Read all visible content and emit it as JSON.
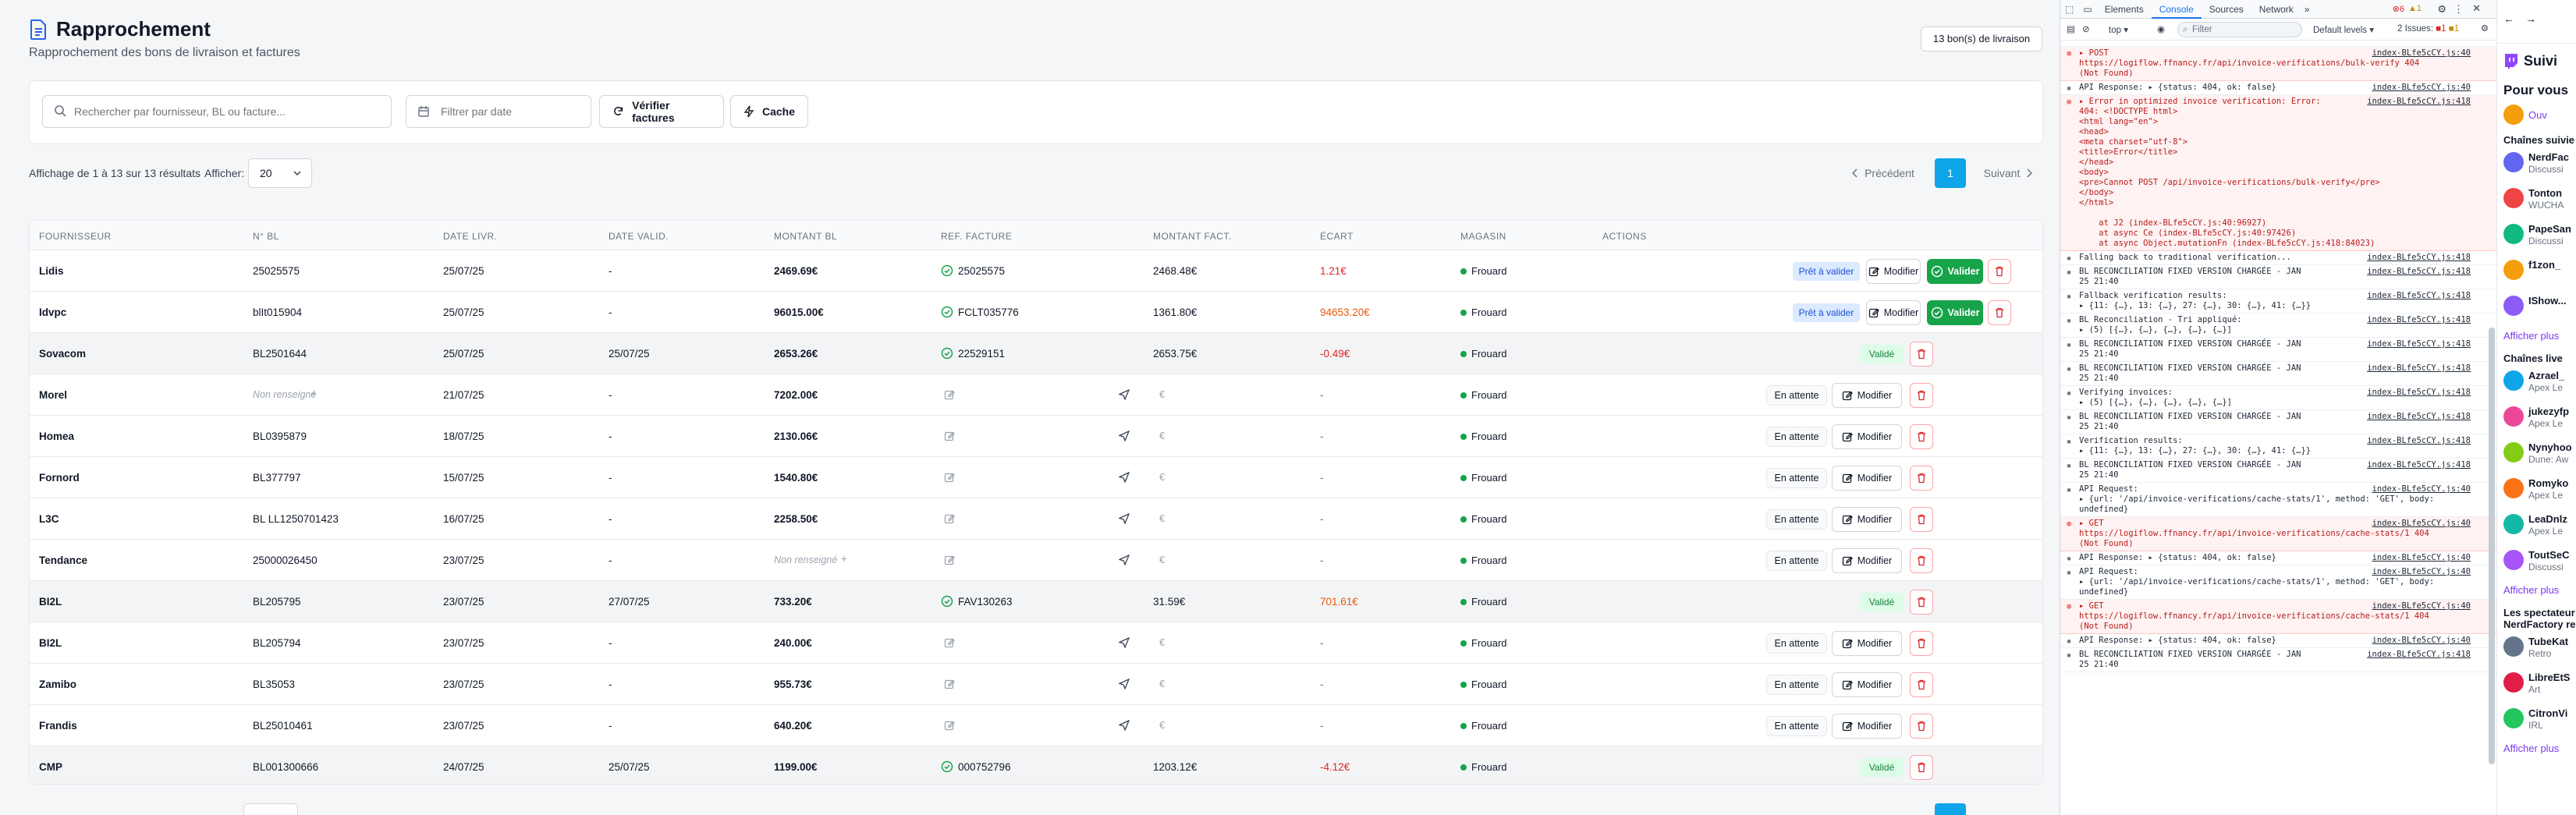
{
  "app": {
    "title": "Rapprochement",
    "subtitle": "Rapprochement des bons de livraison et factures",
    "count_badge": "13 bon(s) de livraison"
  },
  "filters": {
    "search_placeholder": "Rechercher par fournisseur, BL ou facture...",
    "date_placeholder": "Filtrer par date",
    "verify_label": "Vérifier factures",
    "cache_label": "Cache"
  },
  "pagination": {
    "info": "Affichage de 1 à 13 sur 13 résultats",
    "show_label": "Afficher:",
    "per_page": "20",
    "prev": "Précédent",
    "current": "1",
    "next": "Suivant"
  },
  "table": {
    "headers": [
      "FOURNISSEUR",
      "N° BL",
      "DATE LIVR.",
      "DATE VALID.",
      "MONTANT BL",
      "REF. FACTURE",
      "MONTANT FACT.",
      "ÉCART",
      "MAGASIN",
      "ACTIONS"
    ],
    "labels": {
      "ready": "Prêt à valider",
      "edit": "Modifier",
      "validate": "Valider",
      "waiting": "En attente",
      "validated": "Validé",
      "not_filled": "Non renseigné",
      "euro": "€"
    },
    "rows": [
      {
        "supplier": "Lidis",
        "bl": "25025575",
        "date_livr": "25/07/25",
        "date_valid": "-",
        "amount_bl": "2469.69€",
        "ref": "25025575",
        "amount_fact": "2468.48€",
        "gap": "1.21€",
        "store": "Frouard",
        "status": "ready"
      },
      {
        "supplier": "Idvpc",
        "bl": "blIt015904",
        "date_livr": "25/07/25",
        "date_valid": "-",
        "amount_bl": "96015.00€",
        "ref": "FCLT035776",
        "amount_fact": "1361.80€",
        "gap": "94653.20€",
        "store": "Frouard",
        "status": "ready"
      },
      {
        "supplier": "Sovacom",
        "bl": "BL2501644",
        "date_livr": "25/07/25",
        "date_valid": "25/07/25",
        "amount_bl": "2653.26€",
        "ref": "22529151",
        "amount_fact": "2653.75€",
        "gap": "-0.49€",
        "store": "Frouard",
        "status": "validated"
      },
      {
        "supplier": "Morel",
        "bl": "Non renseigné",
        "date_livr": "21/07/25",
        "date_valid": "-",
        "amount_bl": "7202.00€",
        "ref": "",
        "amount_fact": "",
        "gap": "-",
        "store": "Frouard",
        "status": "waiting"
      },
      {
        "supplier": "Homea",
        "bl": "BL0395879",
        "date_livr": "18/07/25",
        "date_valid": "-",
        "amount_bl": "2130.06€",
        "ref": "",
        "amount_fact": "",
        "gap": "-",
        "store": "Frouard",
        "status": "waiting"
      },
      {
        "supplier": "Fornord",
        "bl": "BL377797",
        "date_livr": "15/07/25",
        "date_valid": "-",
        "amount_bl": "1540.80€",
        "ref": "",
        "amount_fact": "",
        "gap": "-",
        "store": "Frouard",
        "status": "waiting"
      },
      {
        "supplier": "L3C",
        "bl": "BL LL1250701423",
        "date_livr": "16/07/25",
        "date_valid": "-",
        "amount_bl": "2258.50€",
        "ref": "",
        "amount_fact": "",
        "gap": "-",
        "store": "Frouard",
        "status": "waiting"
      },
      {
        "supplier": "Tendance",
        "bl": "25000026450",
        "date_livr": "23/07/25",
        "date_valid": "-",
        "amount_bl": "Non renseigné",
        "ref": "",
        "amount_fact": "",
        "gap": "-",
        "store": "Frouard",
        "status": "waiting"
      },
      {
        "supplier": "BI2L",
        "bl": "BL205795",
        "date_livr": "23/07/25",
        "date_valid": "27/07/25",
        "amount_bl": "733.20€",
        "ref": "FAV130263",
        "amount_fact": "31.59€",
        "gap": "701.61€",
        "store": "Frouard",
        "status": "validated"
      },
      {
        "supplier": "BI2L",
        "bl": "BL205794",
        "date_livr": "23/07/25",
        "date_valid": "-",
        "amount_bl": "240.00€",
        "ref": "",
        "amount_fact": "",
        "gap": "-",
        "store": "Frouard",
        "status": "waiting"
      },
      {
        "supplier": "Zamibo",
        "bl": "BL35053",
        "date_livr": "23/07/25",
        "date_valid": "-",
        "amount_bl": "955.73€",
        "ref": "",
        "amount_fact": "",
        "gap": "-",
        "store": "Frouard",
        "status": "waiting"
      },
      {
        "supplier": "Frandis",
        "bl": "BL25010461",
        "date_livr": "23/07/25",
        "date_valid": "-",
        "amount_bl": "640.20€",
        "ref": "",
        "amount_fact": "",
        "gap": "-",
        "store": "Frouard",
        "status": "waiting"
      },
      {
        "supplier": "CMP",
        "bl": "BL001300666",
        "date_livr": "24/07/25",
        "date_valid": "25/07/25",
        "amount_bl": "1199.00€",
        "ref": "000752796",
        "amount_fact": "1203.12€",
        "gap": "-4.12€",
        "store": "Frouard",
        "status": "validated"
      }
    ]
  },
  "devtools": {
    "tabs": [
      "Elements",
      "Console",
      "Sources",
      "Network"
    ],
    "context": "top",
    "filter_placeholder": "Filter",
    "levels": "Default levels",
    "issues": "2 Issues:",
    "counts": {
      "errors": "6",
      "warnings": "1"
    },
    "lines": [
      {
        "type": "err",
        "text": "▸ POST\nhttps://logiflow.ffnancy.fr/api/invoice-verifications/bulk-verify 404\n(Not Found)",
        "src": "index-BLfe5cCY.js:40"
      },
      {
        "type": "log",
        "text": "API Response: ▸ {status: 404, ok: false}",
        "src": "index-BLfe5cCY.js:40"
      },
      {
        "type": "err",
        "text": "▸ Error in optimized invoice verification: Error:\n404: <!DOCTYPE html>\n<html lang=\"en\">\n<head>\n<meta charset=\"utf-8\">\n<title>Error</title>\n</head>\n<body>\n<pre>Cannot POST /api/invoice-verifications/bulk-verify</pre>\n</body>\n</html>\n\n    at J2 (index-BLfe5cCY.js:40:96927)\n    at async Ce (index-BLfe5cCY.js:40:97426)\n    at async Object.mutationFn (index-BLfe5cCY.js:418:84023)",
        "src": "index-BLfe5cCY.js:418"
      },
      {
        "type": "log",
        "text": "Falling back to traditional verification...",
        "src": "index-BLfe5cCY.js:418"
      },
      {
        "type": "log",
        "text": "BL RECONCILIATION FIXED VERSION CHARGÉE - JAN\n25 21:40",
        "src": "index-BLfe5cCY.js:418"
      },
      {
        "type": "log",
        "text": "Fallback verification results:\n▸ {11: {…}, 13: {…}, 27: {…}, 30: {…}, 41: {…}}",
        "src": "index-BLfe5cCY.js:418"
      },
      {
        "type": "log",
        "text": "BL Reconciliation - Tri appliqué:\n▸ (5) [{…}, {…}, {…}, {…}, {…}]",
        "src": "index-BLfe5cCY.js:418"
      },
      {
        "type": "log",
        "text": "BL RECONCILIATION FIXED VERSION CHARGÉE - JAN\n25 21:40",
        "src": "index-BLfe5cCY.js:418"
      },
      {
        "type": "log",
        "text": "BL RECONCILIATION FIXED VERSION CHARGÉE - JAN\n25 21:40",
        "src": "index-BLfe5cCY.js:418"
      },
      {
        "type": "log",
        "text": "Verifying invoices:\n▸ (5) [{…}, {…}, {…}, {…}, {…}]",
        "src": "index-BLfe5cCY.js:418"
      },
      {
        "type": "log",
        "text": "BL RECONCILIATION FIXED VERSION CHARGÉE - JAN\n25 21:40",
        "src": "index-BLfe5cCY.js:418"
      },
      {
        "type": "log",
        "text": "Verification results:\n▸ {11: {…}, 13: {…}, 27: {…}, 30: {…}, 41: {…}}",
        "src": "index-BLfe5cCY.js:418"
      },
      {
        "type": "log",
        "text": "BL RECONCILIATION FIXED VERSION CHARGÉE - JAN\n25 21:40",
        "src": "index-BLfe5cCY.js:418"
      },
      {
        "type": "log",
        "text": "API Request:\n▸ {url: '/api/invoice-verifications/cache-stats/1', method: 'GET', body:\nundefined}",
        "src": "index-BLfe5cCY.js:40"
      },
      {
        "type": "err",
        "text": "▸ GET\nhttps://logiflow.ffnancy.fr/api/invoice-verifications/cache-stats/1 404\n(Not Found)",
        "src": "index-BLfe5cCY.js:40"
      },
      {
        "type": "log",
        "text": "API Response: ▸ {status: 404, ok: false}",
        "src": "index-BLfe5cCY.js:40"
      },
      {
        "type": "log",
        "text": "API Request:\n▸ {url: '/api/invoice-verifications/cache-stats/1', method: 'GET', body:\nundefined}",
        "src": "index-BLfe5cCY.js:40"
      },
      {
        "type": "err",
        "text": "▸ GET\nhttps://logiflow.ffnancy.fr/api/invoice-verifications/cache-stats/1 404\n(Not Found)",
        "src": "index-BLfe5cCY.js:40"
      },
      {
        "type": "log",
        "text": "API Response: ▸ {status: 404, ok: false}",
        "src": "index-BLfe5cCY.js:40"
      },
      {
        "type": "log",
        "text": "BL RECONCILIATION FIXED VERSION CHARGÉE - JAN\n25 21:40",
        "src": "index-BLfe5cCY.js:418"
      }
    ]
  },
  "twitch": {
    "title": "Suivi",
    "for_you": "Pour vous",
    "open": "Ouv",
    "followed_heading": "Chaînes suivie",
    "followed": [
      {
        "name": "NerdFac",
        "sub": "Discussi"
      },
      {
        "name": "Tonton",
        "sub": "WUCHA"
      },
      {
        "name": "PapeSan",
        "sub": "Discussi"
      },
      {
        "name": "f1zon_",
        "sub": ""
      },
      {
        "name": "IShow...",
        "sub": ""
      }
    ],
    "more": "Afficher plus",
    "live_heading": "Chaînes live",
    "live": [
      {
        "name": "Azrael_",
        "sub": "Apex Le"
      },
      {
        "name": "jukezyfp",
        "sub": "Apex Le"
      },
      {
        "name": "Nynyhoo",
        "sub": "Dune: Aw"
      },
      {
        "name": "Romyko",
        "sub": "Apex Le"
      },
      {
        "name": "LeaDnlz",
        "sub": "Apex Le"
      },
      {
        "name": "ToutSeC",
        "sub": "Discussi"
      }
    ],
    "viewers_heading": "Les spectateur\nNerdFactory re",
    "viewers": [
      {
        "name": "TubeKat",
        "sub": "Retro"
      },
      {
        "name": "LibreEtS",
        "sub": "Art"
      },
      {
        "name": "CitronVi",
        "sub": "IRL"
      }
    ],
    "more2": "Afficher plus",
    "more3": "Afficher plus"
  },
  "colors": {
    "accent": "#0ea5e9",
    "success": "#16a34a",
    "danger": "#dc2626",
    "warning": "#ea580c",
    "badge_ready": "#dbeafe"
  }
}
